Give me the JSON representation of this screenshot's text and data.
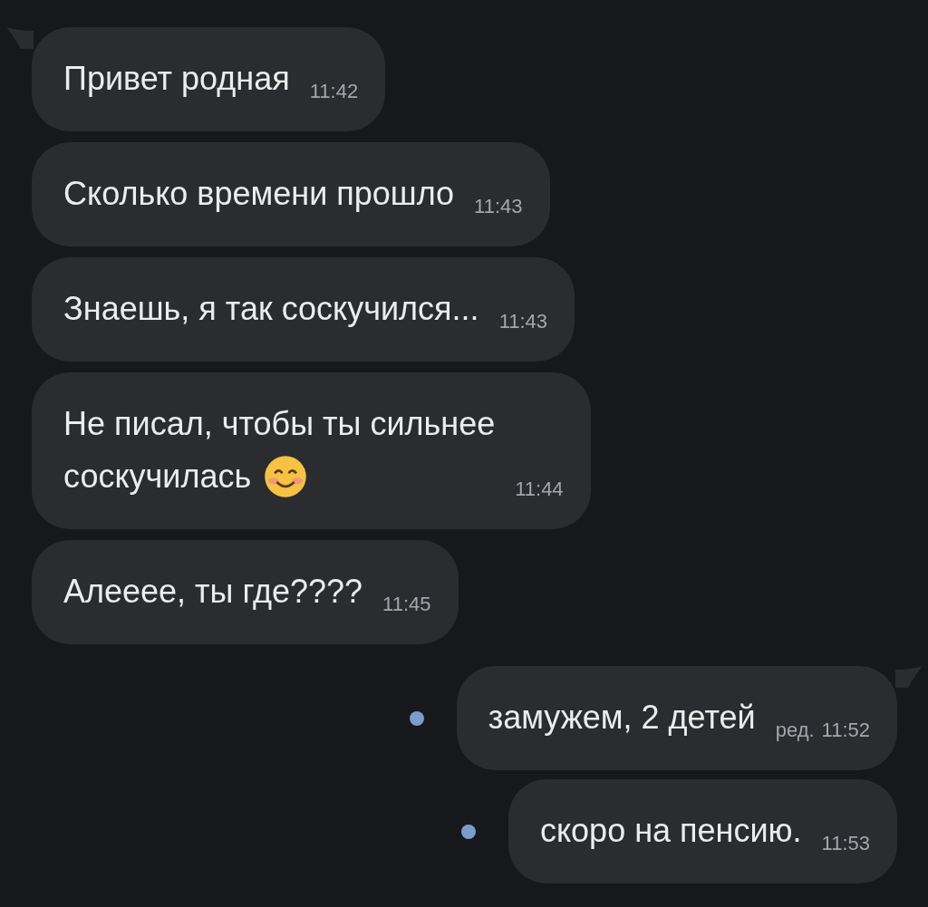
{
  "messages": [
    {
      "kind": "incoming",
      "tail": true,
      "lines": [
        "Привет родная"
      ],
      "time": "11:42"
    },
    {
      "kind": "incoming",
      "tail": false,
      "lines": [
        "Сколько времени прошло"
      ],
      "time": "11:43"
    },
    {
      "kind": "incoming",
      "tail": false,
      "lines": [
        "Знаешь, я так соскучился..."
      ],
      "time": "11:43"
    },
    {
      "kind": "incoming",
      "tail": false,
      "lines": [
        "Не писал, чтобы ты сильнее",
        "соскучилась"
      ],
      "emoji": true,
      "time": "11:44"
    },
    {
      "kind": "incoming",
      "tail": false,
      "lines": [
        "Алеееe, ты где????"
      ],
      "time": "11:45"
    },
    {
      "kind": "outgoing",
      "tail": true,
      "unread": true,
      "lines": [
        "замужем, 2 детей"
      ],
      "edited": "ред.",
      "time": "11:52"
    },
    {
      "kind": "outgoing",
      "tail": false,
      "unread": true,
      "lines": [
        "скоро на пенсию."
      ],
      "time": "11:53"
    }
  ]
}
